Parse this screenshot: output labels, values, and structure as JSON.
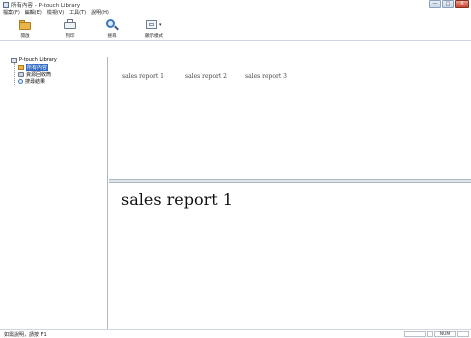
{
  "window": {
    "title": "所有內容 - P-touch Library",
    "buttons": {
      "minimize": "—",
      "maximize": "□",
      "close": "X"
    }
  },
  "menu": {
    "items": [
      "檔案(F)",
      "編輯(E)",
      "檢視(V)",
      "工具(T)",
      "說明(H)"
    ]
  },
  "toolbar": {
    "open_label": "開啟",
    "print_label": "列印",
    "search_label": "搜尋",
    "view_label": "顯示樣式"
  },
  "tree": {
    "root_label": "P-touch Library",
    "items": [
      {
        "label": "所有內容",
        "icon": "folder-icon",
        "selected": true
      },
      {
        "label": "資源回收筒",
        "icon": "trash-icon",
        "selected": false
      },
      {
        "label": "搜尋結果",
        "icon": "search-icon",
        "selected": false
      }
    ]
  },
  "thumbnails": [
    "sales report 1",
    "sales report 2",
    "sales report 3"
  ],
  "preview": {
    "text": "sales report 1"
  },
  "status": {
    "help_text": "如需說明，請按 F1",
    "num_indicator": "NUM"
  }
}
